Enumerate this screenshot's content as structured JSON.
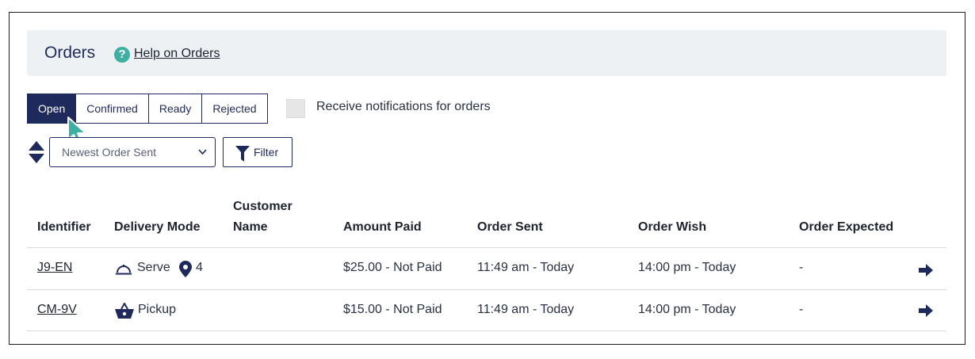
{
  "header": {
    "title": "Orders",
    "help_icon": "?",
    "help_link": "Help on Orders"
  },
  "tabs": [
    {
      "label": "Open",
      "active": true
    },
    {
      "label": "Confirmed",
      "active": false
    },
    {
      "label": "Ready",
      "active": false
    },
    {
      "label": "Rejected",
      "active": false
    }
  ],
  "notifications": {
    "label": "Receive notifications for orders",
    "checked": false
  },
  "sort": {
    "selected": "Newest Order Sent",
    "icon": "sort-updown-icon"
  },
  "filter": {
    "label": "Filter",
    "icon": "funnel-icon"
  },
  "table": {
    "headers": {
      "identifier": "Identifier",
      "delivery_mode": "Delivery Mode",
      "customer_name_1": "Customer",
      "customer_name_2": "Name",
      "amount_paid": "Amount Paid",
      "order_sent": "Order Sent",
      "order_wish": "Order Wish",
      "order_expected": "Order Expected"
    },
    "rows": [
      {
        "identifier": "J9-EN",
        "delivery_mode": "Serve",
        "delivery_icon": "cloche-icon",
        "table_icon": "map-pin-icon",
        "table_number": "4",
        "customer_name": "",
        "amount_paid": "$25.00 - Not Paid",
        "order_sent": "11:49 am - Today",
        "order_wish": "14:00 pm - Today",
        "order_expected": "-"
      },
      {
        "identifier": "CM-9V",
        "delivery_mode": "Pickup",
        "delivery_icon": "basket-icon",
        "customer_name": "",
        "amount_paid": "$15.00 - Not Paid",
        "order_sent": "11:49 am - Today",
        "order_wish": "14:00 pm - Today",
        "order_expected": "-"
      }
    ]
  },
  "colors": {
    "primary": "#1f2a5c",
    "accent": "#3cb0a2",
    "header_bg": "#eef1f4"
  }
}
